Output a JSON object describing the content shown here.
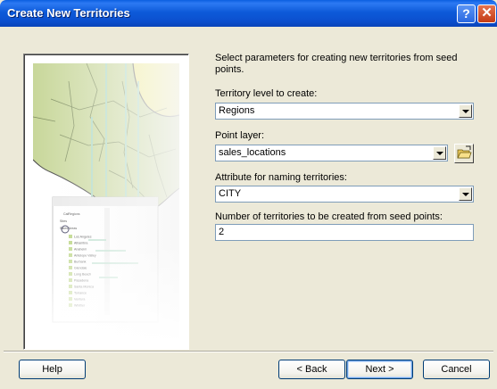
{
  "window": {
    "title": "Create New Territories"
  },
  "intro": "Select parameters for creating new territories from seed points.",
  "fields": {
    "territory_level": {
      "label": "Territory level to create:",
      "value": "Regions"
    },
    "point_layer": {
      "label": "Point layer:",
      "value": "sales_locations"
    },
    "naming_attribute": {
      "label": "Attribute for naming territories:",
      "value": "CITY"
    },
    "territory_count": {
      "label": "Number of territories to be created from seed points:",
      "value": "2"
    }
  },
  "buttons": {
    "help": "Help",
    "back": "< Back",
    "next": "Next >",
    "cancel": "Cancel"
  },
  "illustration": {
    "items": [
      "CalRegions",
      "Sites",
      "Sales Areas",
      "Los Angeles",
      "Alhambra",
      "Anaheim",
      "Antelope Valley",
      "Burbank",
      "Glendale",
      "Long Beach",
      "Pasadena",
      "Santa Monica",
      "Torrance",
      "Ventura",
      "Whittier"
    ]
  },
  "colors": {
    "title_bar": "#0b57d6",
    "dialog_bg": "#ece9d8",
    "map_land": "#c8d79a",
    "map_sea": "#ffffff",
    "map_highlight": "#f3ee8e"
  }
}
